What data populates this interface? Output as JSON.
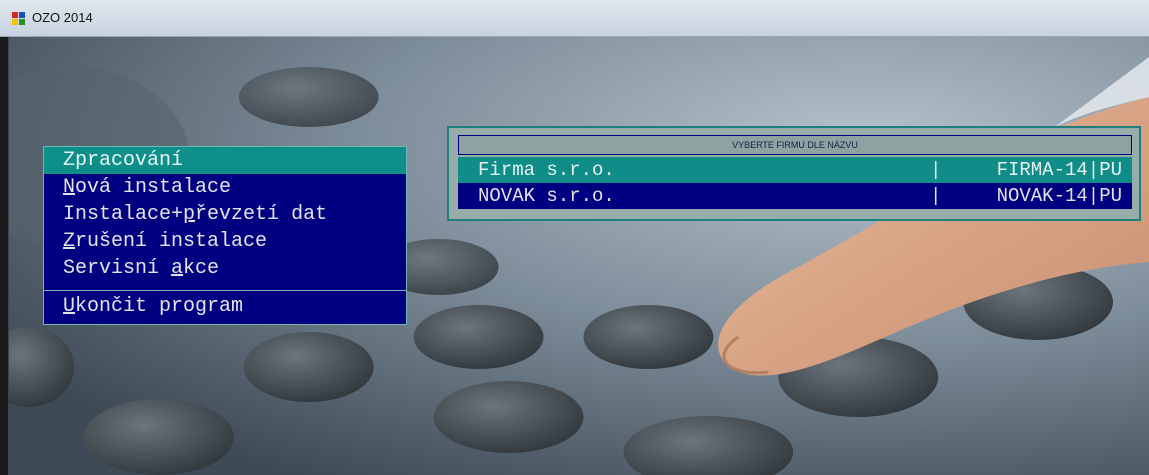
{
  "window": {
    "title": "OZO 2014",
    "icon": "app-icon"
  },
  "menu": {
    "items": [
      {
        "label": "Zpracování",
        "selected": true
      },
      {
        "pre": "",
        "accel": "N",
        "post": "ová instalace"
      },
      {
        "pre": "Instalace+",
        "accel": "p",
        "post": "řevzetí dat"
      },
      {
        "pre": "",
        "accel": "Z",
        "post": "rušení instalace"
      },
      {
        "pre": "Servisní ",
        "accel": "a",
        "post": "kce"
      },
      {
        "pre": "",
        "accel": "U",
        "post": "končit program"
      }
    ]
  },
  "company_picker": {
    "title": "VYBERTE FIRMU DLE NÁZVU",
    "separator": "|",
    "rows": [
      {
        "name": "Firma s.r.o.",
        "code": "FIRMA-14|PU",
        "selected": true
      },
      {
        "name": "NOVAK s.r.o.",
        "code": "NOVAK-14|PU",
        "selected": false
      }
    ]
  },
  "colors": {
    "menu_bg": "#000080",
    "highlight": "#108d88",
    "panel_bg": "#96ada9"
  }
}
